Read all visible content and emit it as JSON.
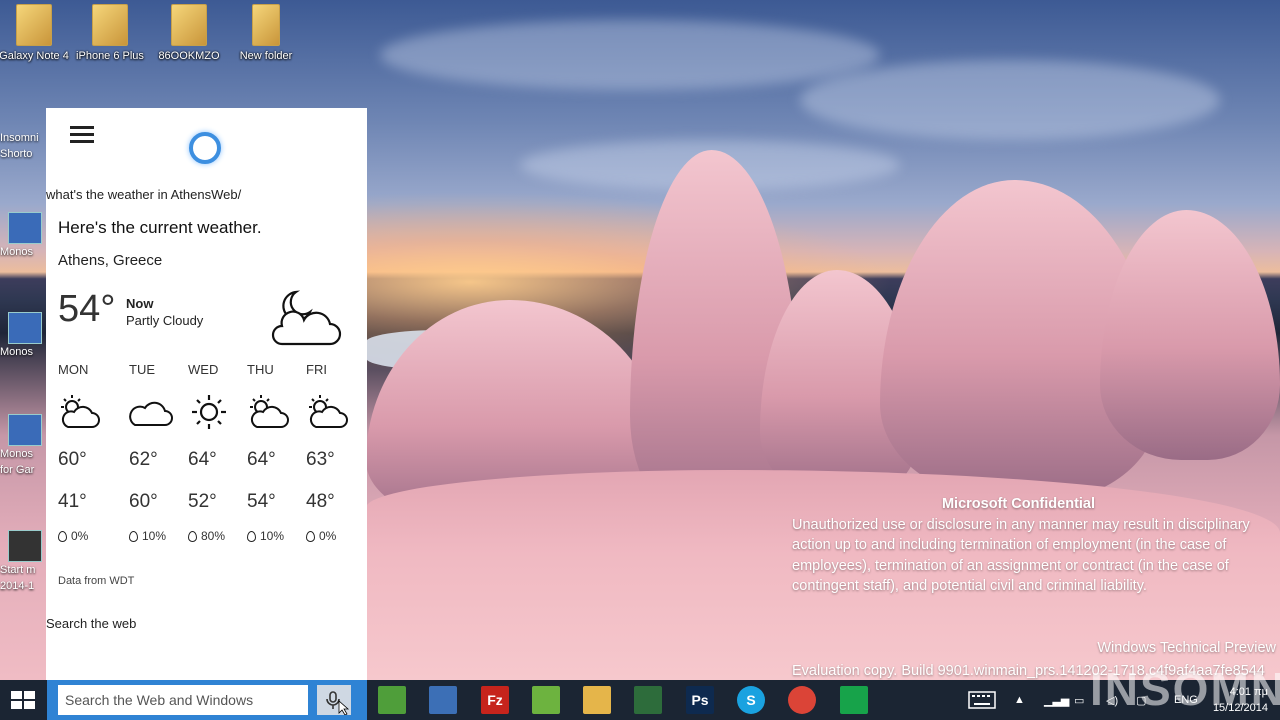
{
  "desktop": {
    "icons": [
      {
        "label": "Galaxy Note 4"
      },
      {
        "label": "iPhone 6 Plus"
      },
      {
        "label": "86OOKMZO"
      },
      {
        "label": "New folder"
      }
    ],
    "left_items": [
      {
        "line1": "Insomni",
        "line2": "Shorto"
      },
      {
        "line1": "Monos",
        "line2": ""
      },
      {
        "line1": "Monos",
        "line2": ""
      },
      {
        "line1": "Monos",
        "line2": "for Gar"
      },
      {
        "line1": "Start m",
        "line2": "2014-1"
      }
    ]
  },
  "cortana": {
    "query": "what's the weather in AthensWeb/",
    "answer": "Here's the current weather.",
    "location": "Athens, Greece",
    "current": {
      "temp": "54°",
      "label": "Now",
      "condition": "Partly Cloudy",
      "icon": "moon-cloud-icon"
    },
    "forecast": [
      {
        "day": "MON",
        "icon": "partly-sunny-icon",
        "high": "60°",
        "low": "41°",
        "precip": "0%"
      },
      {
        "day": "TUE",
        "icon": "cloud-icon",
        "high": "62°",
        "low": "60°",
        "precip": "10%"
      },
      {
        "day": "WED",
        "icon": "sun-icon",
        "high": "64°",
        "low": "52°",
        "precip": "80%"
      },
      {
        "day": "THU",
        "icon": "partly-sunny-icon",
        "high": "64°",
        "low": "54°",
        "precip": "10%"
      },
      {
        "day": "FRI",
        "icon": "partly-sunny-icon",
        "high": "63°",
        "low": "48°",
        "precip": "0%"
      }
    ],
    "data_source": "Data from WDT",
    "search_web": "Search the web"
  },
  "notice": {
    "title": "Microsoft Confidential",
    "body": "Unauthorized use or disclosure in any manner may result in disciplinary action up to and including termination of employment (in the case of employees), termination of an assignment or contract (in the case of contingent staff), and potential civil and criminal liability.",
    "product": "Windows Technical Preview",
    "build": "Evaluation copy. Build 9901.winmain_prs.141202-1718.c4f9af4aa7fe8544"
  },
  "taskbar": {
    "search_placeholder": "Search the Web and Windows",
    "apps": [
      {
        "name": "evernote-icon",
        "glyph": "",
        "color": "#4f9e3a"
      },
      {
        "name": "network-icon",
        "glyph": "",
        "color": "#3c6fb6"
      },
      {
        "name": "filezilla-icon",
        "glyph": "Fz",
        "color": "#c6241c"
      },
      {
        "name": "spotify-icon",
        "glyph": "",
        "color": "#6db33f"
      },
      {
        "name": "file-explorer-icon",
        "glyph": "",
        "color": "#e5b54a"
      },
      {
        "name": "video-app-icon",
        "glyph": "",
        "color": "#2d6c3b"
      },
      {
        "name": "photoshop-icon",
        "glyph": "Ps",
        "color": "#0e2a4f"
      },
      {
        "name": "skype-icon",
        "glyph": "S",
        "color": "#1aa2e0"
      },
      {
        "name": "chrome-icon",
        "glyph": "",
        "color": "#db4437"
      },
      {
        "name": "store-icon",
        "glyph": "",
        "color": "#17a34a"
      }
    ],
    "lang": "ENG",
    "time": "4:01 πμ",
    "date": "15/12/2014"
  },
  "watermark": "INSOMNIA"
}
